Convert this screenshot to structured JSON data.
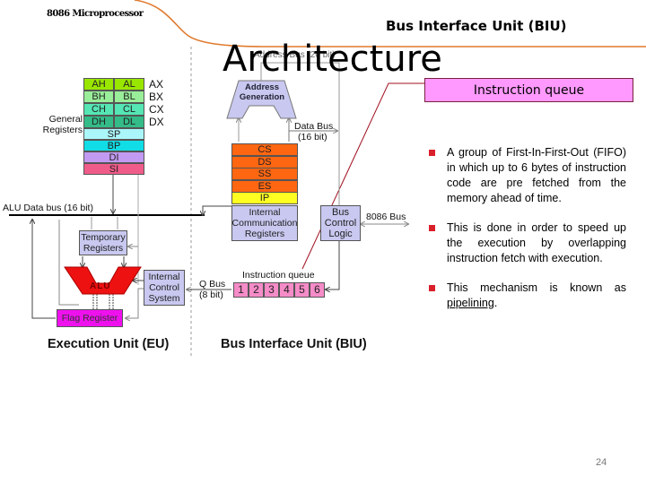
{
  "header": {
    "course_label": "8086 Microprocessor",
    "title": "Bus Interface Unit (BIU)",
    "subtitle_overlay": "Architecture"
  },
  "callout": {
    "label": "Instruction queue"
  },
  "bullets": [
    {
      "text": "A group of First-In-First-Out (FIFO) in which up to 6 bytes of instruction code are pre fetched from the memory ahead of time."
    },
    {
      "text": "This is done in order to speed up the execution by overlapping instruction fetch with execution."
    },
    {
      "text_before": "This mechanism is known as ",
      "link": "pipelining",
      "text_after": "."
    }
  ],
  "page_number": "24",
  "diagram": {
    "general_registers_label": "General Registers",
    "register_pairs": [
      {
        "high": "AH",
        "low": "AL",
        "name": "AX",
        "color": "#99e600"
      },
      {
        "high": "BH",
        "low": "BL",
        "name": "BX",
        "color": "#99ee99"
      },
      {
        "high": "CH",
        "low": "CL",
        "name": "CX",
        "color": "#55e6b4"
      },
      {
        "high": "DH",
        "low": "DL",
        "name": "DX",
        "color": "#33bb88"
      }
    ],
    "pointer_registers": [
      {
        "name": "SP",
        "color": "#aaf6fa"
      },
      {
        "name": "BP",
        "color": "#11dde6"
      },
      {
        "name": "DI",
        "color": "#c29af2"
      },
      {
        "name": "SI",
        "color": "#f05c8a"
      }
    ],
    "alu_data_bus_label": "ALU Data bus (16 bit)",
    "temporary_registers": "Temporary Registers",
    "alu_label": "ALU",
    "flag_register": "Flag Register",
    "internal_control_system": "Internal Control System",
    "q_bus_label": "Q Bus",
    "q_bus_width": "(8 bit)",
    "address_bus_label": "Address Bus (20 bit)",
    "address_generation": "Address Generation",
    "data_bus_label": "Data Bus",
    "data_bus_width": "(16 bit)",
    "segment_registers": [
      {
        "name": "CS",
        "color": "#ff6611"
      },
      {
        "name": "DS",
        "color": "#ff6611"
      },
      {
        "name": "SS",
        "color": "#ff6611"
      },
      {
        "name": "ES",
        "color": "#ff6611"
      },
      {
        "name": "IP",
        "color": "#ffff22"
      }
    ],
    "internal_comm_registers": "Internal Communication Registers",
    "bus_control_logic": "Bus Control Logic",
    "system_bus_label": "8086 Bus",
    "instruction_queue_label": "Instruction queue",
    "queue_slots": [
      "1",
      "2",
      "3",
      "4",
      "5",
      "6"
    ],
    "eu_label": "Execution Unit (EU)",
    "biu_label": "Bus Interface Unit (BIU)"
  },
  "colors": {
    "accent_orange": "#e07a2e",
    "callout_fill": "#ff99ff",
    "bullet_red": "#d9202a",
    "alu_red": "#ee1111",
    "flag_magenta": "#ee11ee",
    "queue_pink": "#f58cc8",
    "box_lavender": "#c8c8f0"
  }
}
